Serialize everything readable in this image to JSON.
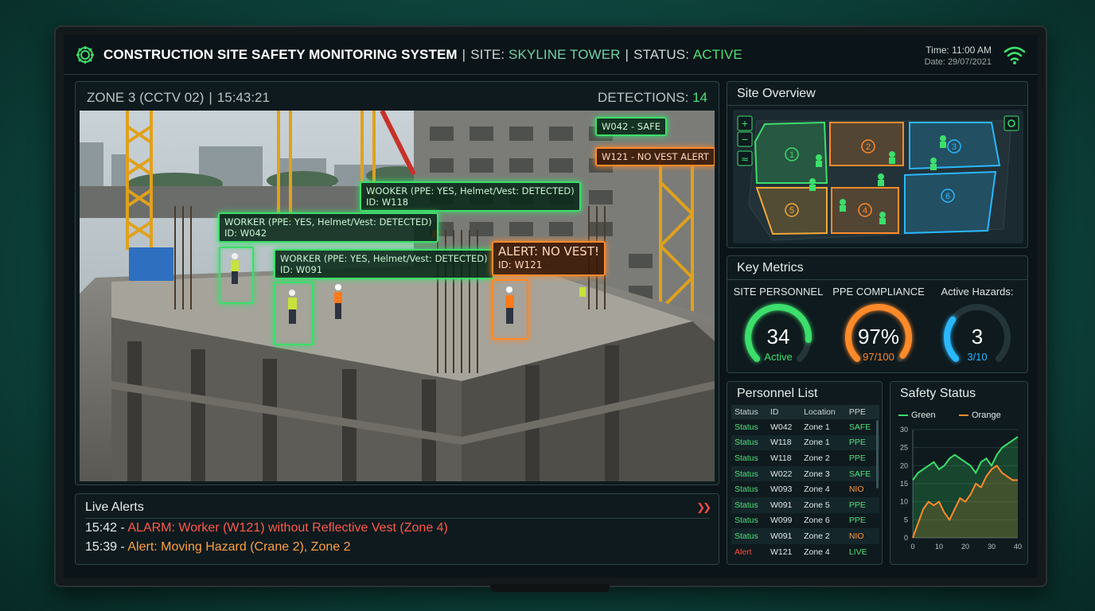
{
  "header": {
    "title": "CONSTRUCTION SITE SAFETY MONITORING SYSTEM",
    "site_label": "SITE:",
    "site_value": "SKYLINE TOWER",
    "status_label": "STATUS:",
    "status_value": "ACTIVE",
    "time": "Time: 11:00 AM",
    "date": "Date: 29/07/2021"
  },
  "camera": {
    "zone": "ZONE 3 (CCTV 02)",
    "timestamp": "15:43:21",
    "detections_label": "DETECTIONS:",
    "detections_value": "14",
    "tags": {
      "w042_safe": "W042 - SAFE",
      "w121_alert": "W121 - NO VEST ALERT",
      "w118_line1": "WOOKER (PPE: YES, Helmet/Vest: DETECTED)",
      "w118_line2": "ID: W118",
      "w042_line1": "WORKER (PPE: YES, Helmet/Vest: DETECTED)",
      "w042_line2": "ID: W042",
      "w091_line1": "WORKER (PPE: YES, Helmet/Vest: DETECTED)",
      "w091_line2": "ID: W091",
      "alert_line1": "ALERT: NO VEST!",
      "alert_line2": "ID: W121"
    }
  },
  "alerts": {
    "title": "Live Alerts",
    "items": [
      {
        "time": "15:42 - ",
        "text": "ALARM: Worker (W121) without Reflective Vest (Zone 4)"
      },
      {
        "time": "15:39 - ",
        "text": "Alert: Moving Hazard (Crane 2), Zone 2"
      }
    ]
  },
  "site_overview": {
    "title": "Site Overview",
    "zones": [
      "1",
      "2",
      "3",
      "4",
      "5",
      "6"
    ],
    "zoom_in": "+",
    "zoom_out": "−",
    "layers": "≈"
  },
  "metrics": {
    "title": "Key Metrics",
    "personnel": {
      "label": "SITE PERSONNEL",
      "value": "34",
      "sub": "Active",
      "fraction": 0.85
    },
    "ppe": {
      "label": "PPE COMPLIANCE",
      "value": "97%",
      "sub": "97/100",
      "fraction": 0.97
    },
    "hazards": {
      "label": "Active Hazards:",
      "value": "3",
      "sub": "3/10",
      "fraction": 0.3
    },
    "colors": {
      "green": "#3dde6b",
      "orange": "#ff8a2a",
      "blue": "#2ab8ff"
    }
  },
  "personnel": {
    "title": "Personnel List",
    "columns": [
      "Status",
      "ID",
      "Location",
      "PPE"
    ],
    "rows": [
      [
        "Status",
        "W042",
        "Zone 1",
        "SAFE"
      ],
      [
        "Status",
        "W118",
        "Zone 1",
        "PPE"
      ],
      [
        "Status",
        "W118",
        "Zone 2",
        "PPE"
      ],
      [
        "Status",
        "W022",
        "Zone 3",
        "SAFE"
      ],
      [
        "Status",
        "W093",
        "Zone 4",
        "NIO"
      ],
      [
        "Status",
        "W091",
        "Zone 5",
        "PPE"
      ],
      [
        "Status",
        "W099",
        "Zone 6",
        "PPE"
      ],
      [
        "Status",
        "W091",
        "Zone 2",
        "NIO"
      ],
      [
        "Alert",
        "W121",
        "Zone 4",
        "LIVE"
      ]
    ]
  },
  "safety": {
    "title": "Safety Status",
    "legend_green": "Green",
    "legend_orange": "Orange"
  },
  "chart_data": {
    "type": "area",
    "title": "Safety Status",
    "x": [
      0,
      2,
      4,
      6,
      8,
      10,
      12,
      14,
      16,
      18,
      20,
      22,
      24,
      26,
      28,
      30,
      32,
      34,
      36,
      38,
      40
    ],
    "series": [
      {
        "name": "Green",
        "color": "#3dde6b",
        "values": [
          16,
          18,
          19,
          20,
          21,
          19,
          20,
          22,
          23,
          22,
          21,
          20,
          18,
          21,
          22,
          20,
          23,
          25,
          26,
          27,
          28
        ]
      },
      {
        "name": "Orange",
        "color": "#ff8a2a",
        "values": [
          0,
          4,
          8,
          10,
          9,
          10,
          7,
          5,
          8,
          11,
          10,
          12,
          15,
          14,
          17,
          19,
          20,
          18,
          17,
          16,
          16
        ]
      }
    ],
    "xlim": [
      0,
      40
    ],
    "ylim": [
      0,
      30
    ],
    "xticks": [
      0,
      10,
      20,
      30,
      40
    ],
    "yticks": [
      0,
      5,
      10,
      15,
      20,
      25,
      30
    ]
  }
}
